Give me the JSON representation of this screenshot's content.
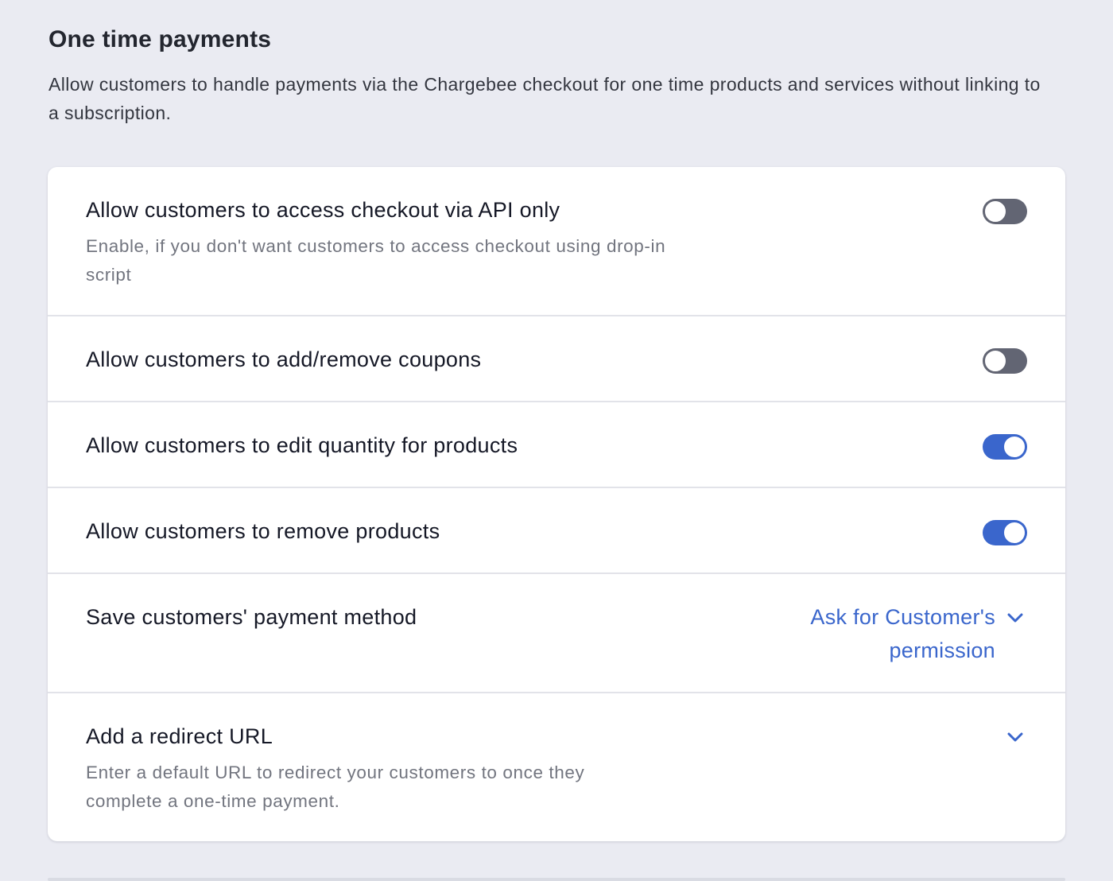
{
  "section": {
    "title": "One time payments",
    "description": "Allow customers to handle payments via the Chargebee checkout for one time products and services without linking to a subscription."
  },
  "settings": {
    "api_only": {
      "label": "Allow customers to access checkout via API only",
      "description": "Enable, if you don't want customers to access checkout using drop-in script",
      "enabled": false
    },
    "coupons": {
      "label": "Allow customers to add/remove coupons",
      "enabled": false
    },
    "edit_quantity": {
      "label": "Allow customers to edit quantity for products",
      "enabled": true
    },
    "remove_products": {
      "label": "Allow customers to remove products",
      "enabled": true
    },
    "save_payment_method": {
      "label": "Save customers' payment method",
      "selected_value": "Ask for Customer's permission",
      "icon": "chevron-down-icon"
    },
    "redirect_url": {
      "label": "Add a redirect URL",
      "description": "Enter a default URL to redirect your customers to once they complete a one-time payment.",
      "icon": "chevron-down-icon"
    }
  },
  "colors": {
    "page_background": "#eaebf2",
    "card_background": "#ffffff",
    "accent": "#3a66cc",
    "toggle_off": "#626573",
    "muted_text": "#72757f"
  }
}
